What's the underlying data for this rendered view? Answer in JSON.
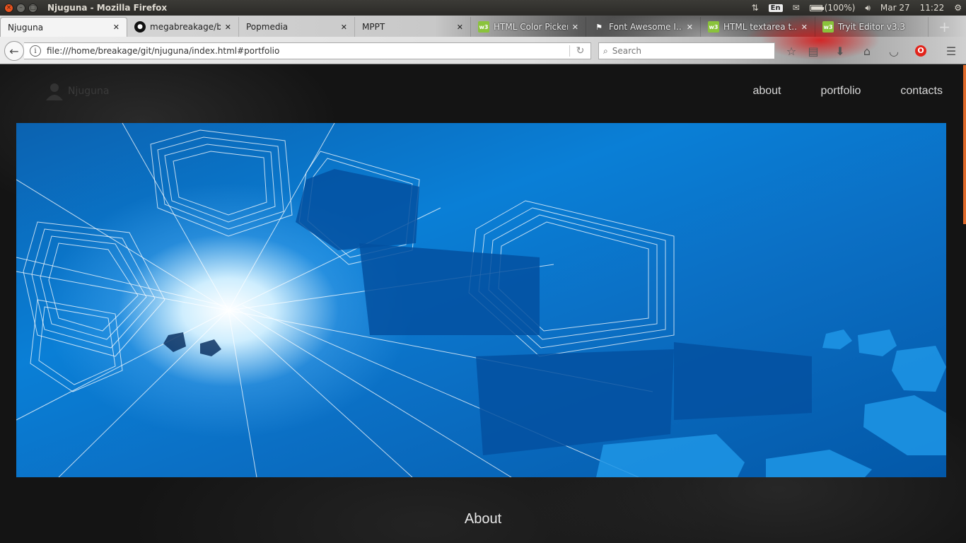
{
  "panel": {
    "window_title": "Njuguna - Mozilla Firefox",
    "keyboard_layout": "En",
    "battery": "(100%)",
    "battery_level": 1.0,
    "date": "Mar 27",
    "time": "11:22"
  },
  "tabs": [
    {
      "label": "Njuguna",
      "favicon": "none",
      "active": true
    },
    {
      "label": "megabreakage/b…",
      "favicon": "github-icon",
      "active": false
    },
    {
      "label": "Popmedia",
      "favicon": "none",
      "active": false
    },
    {
      "label": "MPPT",
      "favicon": "none",
      "active": false
    },
    {
      "label": "HTML Color Picker",
      "favicon": "w3schools-icon",
      "active": false
    },
    {
      "label": "Font Awesome I…",
      "favicon": "flag-icon",
      "active": false
    },
    {
      "label": "HTML textarea t…",
      "favicon": "w3schools-icon",
      "active": false
    },
    {
      "label": "Tryit Editor v3.3",
      "favicon": "w3schools-icon",
      "active": false
    }
  ],
  "navbar": {
    "url": "file:///home/breakage/git/njuguna/index.html#portfolio",
    "search_placeholder": "Search"
  },
  "site": {
    "brand": "Njuguna",
    "nav": [
      "about",
      "portfolio",
      "contacts"
    ],
    "section_heading": "About"
  },
  "colors": {
    "accent_scroll": "#e06a2a",
    "hero_blue": "#0a7fd6"
  }
}
